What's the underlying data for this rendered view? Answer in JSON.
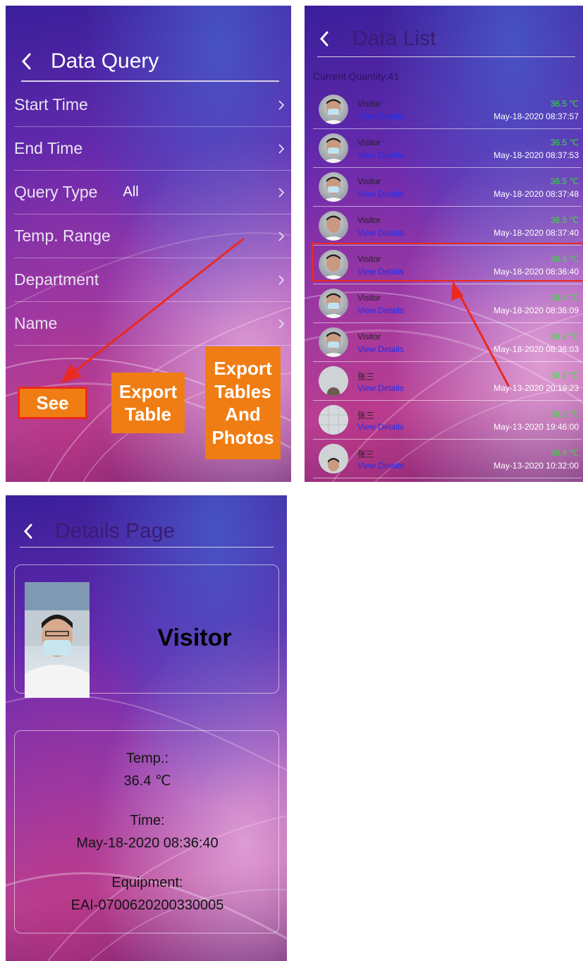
{
  "data_query": {
    "title": "Data Query",
    "items": [
      {
        "label": "Start Time",
        "value": ""
      },
      {
        "label": "End Time",
        "value": ""
      },
      {
        "label": "Query Type",
        "value": "All"
      },
      {
        "label": "Temp. Range",
        "value": ""
      },
      {
        "label": "Department",
        "value": ""
      },
      {
        "label": "Name",
        "value": ""
      }
    ],
    "buttons": {
      "see": "See",
      "export_table": "Export Table",
      "export_tables_photos": "Export Tables And Photos"
    }
  },
  "data_list": {
    "title": "Data List",
    "quantity_text": "Current Quantity:41",
    "view_label": "View Details",
    "rows": [
      {
        "name": "Visitor",
        "temp": "36.5 ℃",
        "time": "May-18-2020 08:37:57"
      },
      {
        "name": "Visitor",
        "temp": "36.5 ℃",
        "time": "May-18-2020 08:37:53"
      },
      {
        "name": "Visitor",
        "temp": "36.5 ℃",
        "time": "May-18-2020 08:37:48"
      },
      {
        "name": "Visitor",
        "temp": "36.5 ℃",
        "time": "May-18-2020 08:37:40"
      },
      {
        "name": "Visitor",
        "temp": "36.4 ℃",
        "time": "May-18-2020 08:36:40"
      },
      {
        "name": "Visitor",
        "temp": "36.4 ℃",
        "time": "May-18-2020 08:36:09"
      },
      {
        "name": "Visitor",
        "temp": "36.4 ℃",
        "time": "May-18-2020 08:36:03"
      },
      {
        "name": "张三",
        "temp": "36.2 ℃",
        "time": "May-13-2020 20:19:23"
      },
      {
        "name": "张三",
        "temp": "36.2 ℃",
        "time": "May-13-2020 19:46:00"
      },
      {
        "name": "张三",
        "temp": "36.4 ℃",
        "time": "May-13-2020 10:32:00"
      }
    ]
  },
  "details": {
    "title": "Details Page",
    "name": "Visitor",
    "temp_label": "Temp.:",
    "temp_value": "36.4 ℃",
    "time_label": "Time:",
    "time_value": "May-18-2020 08:36:40",
    "equipment_label": "Equipment:",
    "equipment_value": "EAI-0700620200330005"
  },
  "colors": {
    "button_orange": "#f07d14",
    "annotation_red": "#ea2a20",
    "temp_green": "#34e03a",
    "link_blue": "#1b2ff0"
  },
  "icons": [
    "back-arrow-icon",
    "chevron-right-icon",
    "avatar-photo"
  ]
}
